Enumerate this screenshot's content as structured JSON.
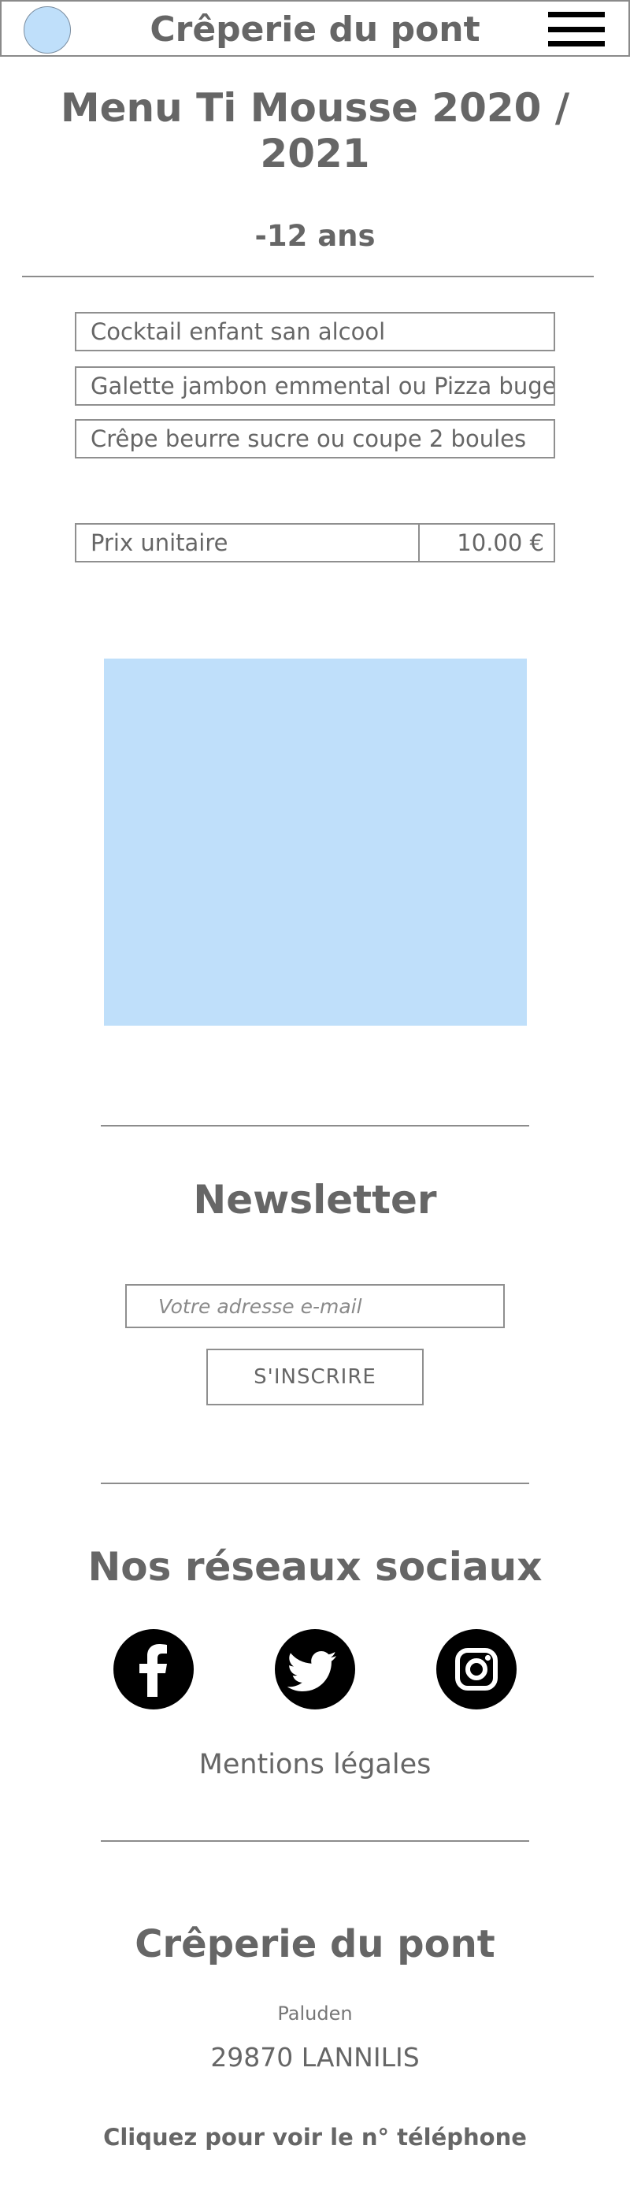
{
  "header": {
    "site_title": "Crêperie du pont"
  },
  "page": {
    "title": "Menu Ti Mousse 2020 / 2021",
    "age_label": "-12 ans"
  },
  "menu": {
    "items": [
      "Cocktail enfant san alcool",
      "Galette jambon emmental ou Pizza bugel",
      "Crêpe beurre sucre ou coupe 2 boules"
    ],
    "price_label": "Prix unitaire",
    "price_value": "10.00 €"
  },
  "newsletter": {
    "title": "Newsletter",
    "email_placeholder": "Votre adresse e-mail",
    "button_label": "S'INSCRIRE"
  },
  "social": {
    "title": "Nos réseaux sociaux",
    "icons": [
      "facebook-icon",
      "twitter-icon",
      "instagram-icon"
    ],
    "legal_link": "Mentions légales"
  },
  "footer": {
    "name": "Crêperie du pont",
    "place": "Paluden",
    "city": "29870 LANNILIS",
    "phone_link": "Cliquez pour voir le n° téléphone"
  },
  "colors": {
    "text": "#666666",
    "logo_fill": "#bfdffa",
    "image_placeholder": "#bfdffa",
    "border": "#8f8f8f",
    "icon_bg": "#000000"
  }
}
